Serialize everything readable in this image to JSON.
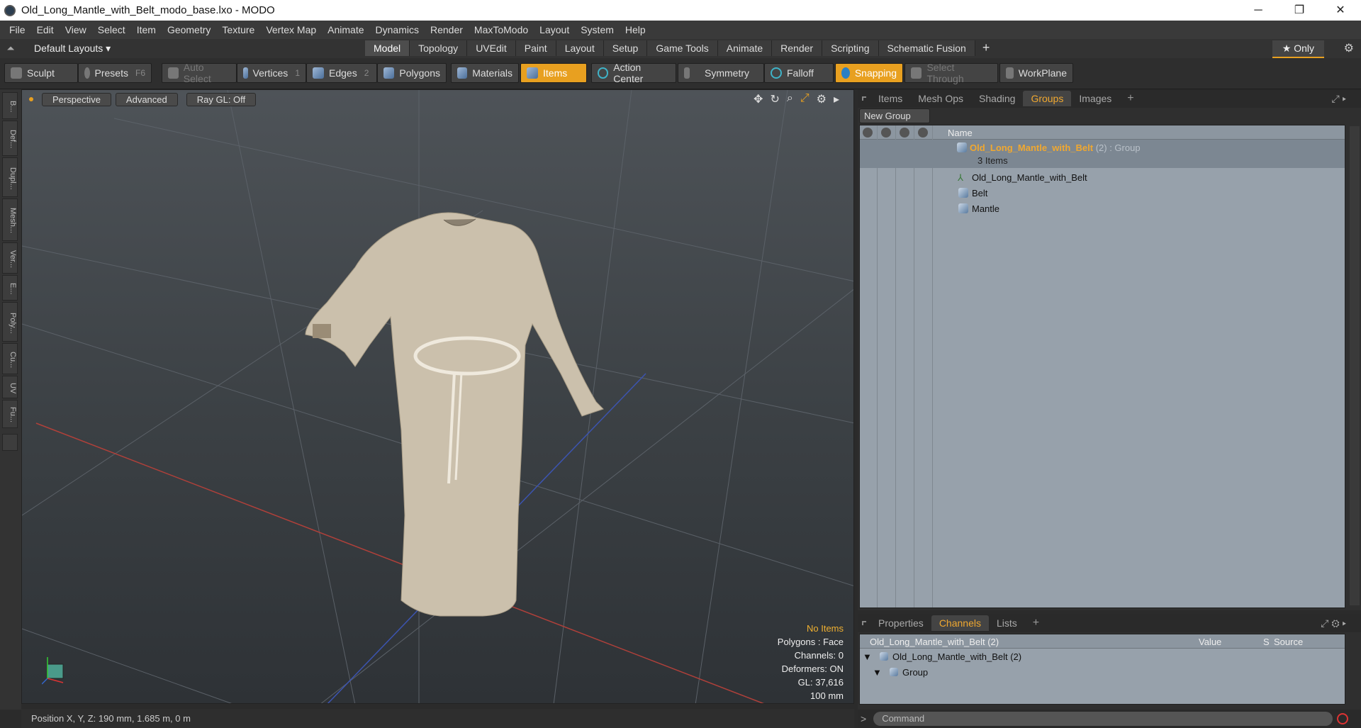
{
  "window": {
    "title": "Old_Long_Mantle_with_Belt_modo_base.lxo - MODO",
    "minimize": "─",
    "maximize": "❐",
    "close": "✕"
  },
  "menu": [
    "File",
    "Edit",
    "View",
    "Select",
    "Item",
    "Geometry",
    "Texture",
    "Vertex Map",
    "Animate",
    "Dynamics",
    "Render",
    "MaxToModo",
    "Layout",
    "System",
    "Help"
  ],
  "layout_bar": {
    "layouts_label": "Default Layouts ▾",
    "tabs": [
      "Model",
      "Topology",
      "UVEdit",
      "Paint",
      "Layout",
      "Setup",
      "Game Tools",
      "Animate",
      "Render",
      "Scripting",
      "Schematic Fusion"
    ],
    "active_tab": "Model",
    "plus": "+",
    "only_label": "★  Only"
  },
  "toolbar": {
    "sculpt": "Sculpt",
    "presets": "Presets",
    "presets_key": "F6",
    "auto_select": "Auto Select",
    "vertices": "Vertices",
    "vertices_count": "1",
    "edges": "Edges",
    "edges_count": "2",
    "polygons": "Polygons",
    "materials": "Materials",
    "items": "Items",
    "action_center": "Action Center",
    "symmetry": "Symmetry",
    "falloff": "Falloff",
    "snapping": "Snapping",
    "select_through": "Select Through",
    "workplane": "WorkPlane"
  },
  "left_strip": [
    "B...",
    "Def...",
    "Dupl...",
    "Mesh...",
    "Ver...",
    "E...",
    "Poly...",
    "Cu...",
    "UV",
    "Fu..."
  ],
  "viewport": {
    "perspective": "Perspective",
    "advanced": "Advanced",
    "raygl": "Ray GL: Off",
    "stats": {
      "no_items": "No Items",
      "polygons": "Polygons : Face",
      "channels": "Channels: 0",
      "deformers": "Deformers: ON",
      "gl": "GL: 37,616",
      "scale": "100 mm"
    }
  },
  "status": {
    "position": "Position X, Y, Z:   190 mm, 1.685 m, 0 m"
  },
  "groups_panel": {
    "tabs": [
      "Items",
      "Mesh Ops",
      "Shading",
      "Groups",
      "Images"
    ],
    "active_tab": "Groups",
    "new_group": "New Group",
    "name_header": "Name",
    "group_name": "Old_Long_Mantle_with_Belt",
    "group_suffix": " (2) : Group",
    "group_count": "3 Items",
    "children": [
      "Old_Long_Mantle_with_Belt",
      "Belt",
      "Mantle"
    ]
  },
  "channels_panel": {
    "tabs": [
      "Properties",
      "Channels",
      "Lists"
    ],
    "active_tab": "Channels",
    "header_name": "Old_Long_Mantle_with_Belt (2)",
    "col_value": "Value",
    "col_s": "S",
    "col_source": "Source",
    "row1": "Old_Long_Mantle_with_Belt (2)",
    "row2": "Group"
  },
  "command": {
    "prompt": ">",
    "placeholder": "Command"
  },
  "colors": {
    "accent_orange": "#e8a020",
    "list_bg": "#97a1ab"
  }
}
